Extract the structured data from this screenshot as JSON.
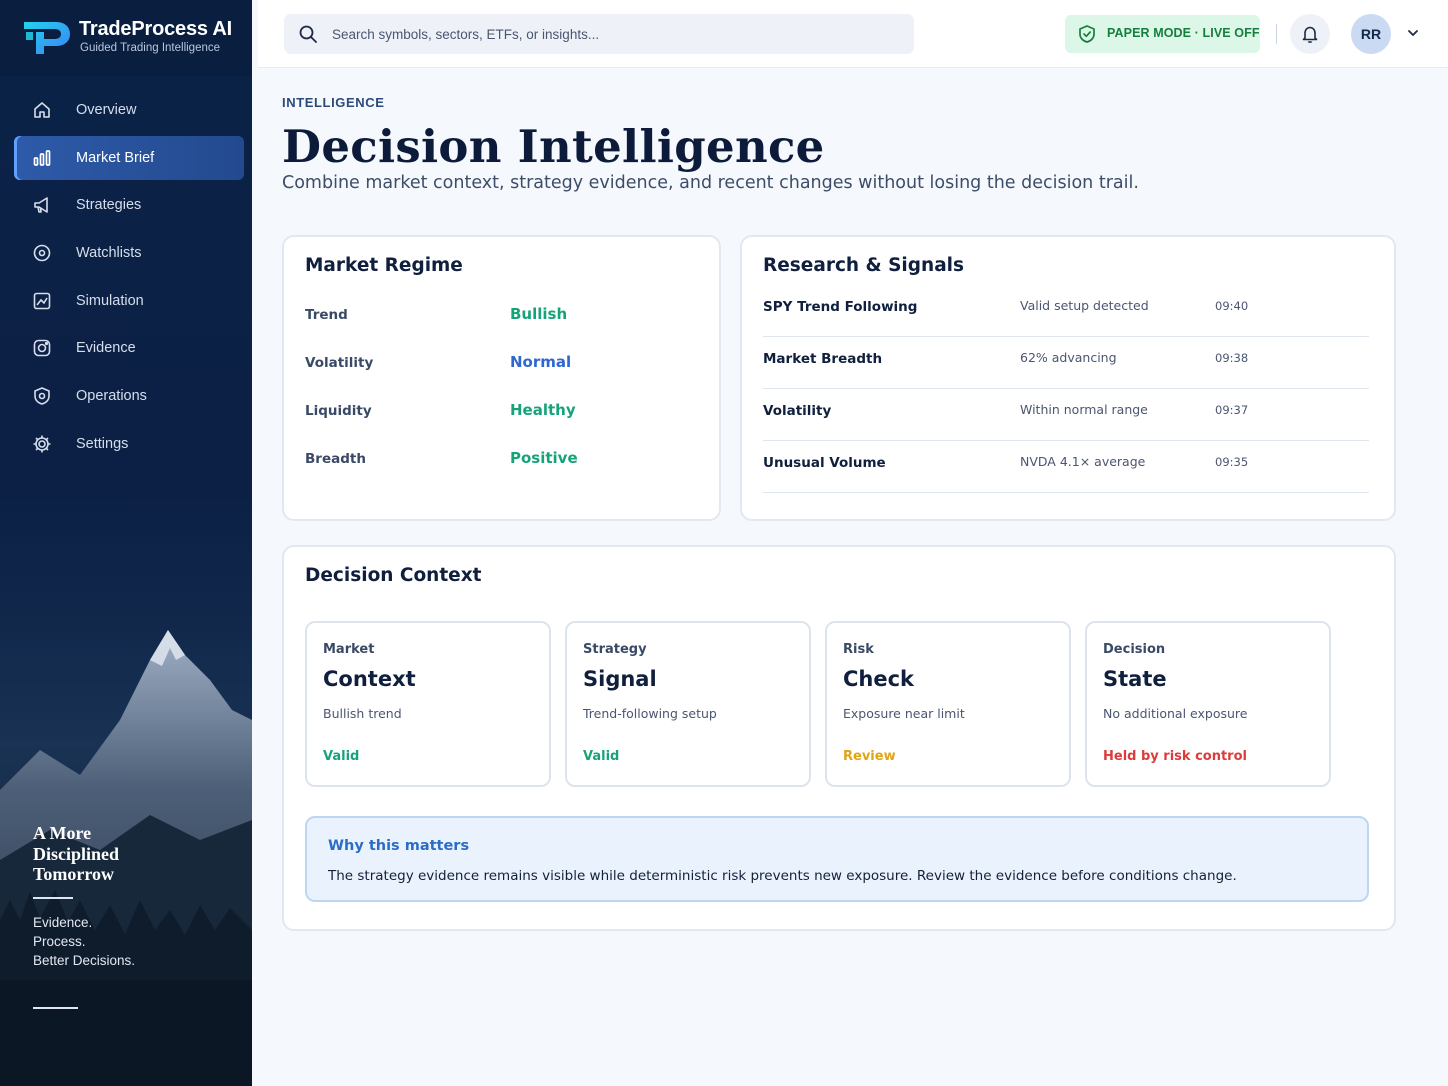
{
  "brand": {
    "name": "TradeProcess AI",
    "tagline": "Guided Trading Intelligence"
  },
  "nav": [
    {
      "label": "Overview",
      "icon": "home-icon",
      "active": false
    },
    {
      "label": "Market Brief",
      "icon": "bar-chart-icon",
      "active": true
    },
    {
      "label": "Strategies",
      "icon": "megaphone-icon",
      "active": false
    },
    {
      "label": "Watchlists",
      "icon": "location-pin-icon",
      "active": false
    },
    {
      "label": "Simulation",
      "icon": "chart-image-icon",
      "active": false
    },
    {
      "label": "Evidence",
      "icon": "camera-icon",
      "active": false
    },
    {
      "label": "Operations",
      "icon": "shield-icon",
      "active": false
    },
    {
      "label": "Settings",
      "icon": "gear-icon",
      "active": false
    }
  ],
  "sidebar_footer": {
    "heading": [
      "A More",
      "Disciplined",
      "Tomorrow"
    ],
    "sub": [
      "Evidence.",
      "Process.",
      "Better Decisions."
    ]
  },
  "topbar": {
    "search_placeholder": "Search symbols, sectors, ETFs, or insights...",
    "mode": "PAPER MODE · LIVE OFF",
    "avatar_initials": "RR"
  },
  "header": {
    "eyebrow": "INTELLIGENCE",
    "title": "Decision Intelligence",
    "subtitle": "Combine market context, strategy evidence, and recent changes without losing the decision trail."
  },
  "market_regime": {
    "title": "Market Regime",
    "rows": [
      {
        "label": "Trend",
        "value": "Bullish",
        "color": "#16a37a"
      },
      {
        "label": "Volatility",
        "value": "Normal",
        "color": "#2f66d0"
      },
      {
        "label": "Liquidity",
        "value": "Healthy",
        "color": "#16a37a"
      },
      {
        "label": "Breadth",
        "value": "Positive",
        "color": "#16a37a"
      }
    ]
  },
  "signals": {
    "title": "Research & Signals",
    "rows": [
      {
        "name": "SPY Trend Following",
        "detail": "Valid setup detected",
        "time": "09:40"
      },
      {
        "name": "Market Breadth",
        "detail": "62% advancing",
        "time": "09:38"
      },
      {
        "name": "Volatility",
        "detail": "Within normal range",
        "time": "09:37"
      },
      {
        "name": "Unusual Volume",
        "detail": "NVDA 4.1× average",
        "time": "09:35"
      }
    ]
  },
  "decision_context": {
    "title": "Decision Context",
    "steps": [
      {
        "eyebrow": "Market",
        "title": "Context",
        "desc": "Bullish trend",
        "status": "Valid",
        "color": "#16a37a"
      },
      {
        "eyebrow": "Strategy",
        "title": "Signal",
        "desc": "Trend-following setup",
        "status": "Valid",
        "color": "#16a37a"
      },
      {
        "eyebrow": "Risk",
        "title": "Check",
        "desc": "Exposure near limit",
        "status": "Review",
        "color": "#e0a516"
      },
      {
        "eyebrow": "Decision",
        "title": "State",
        "desc": "No additional exposure",
        "status": "Held by risk control",
        "color": "#dc3b3b"
      }
    ],
    "why": {
      "title": "Why this matters",
      "body": "The strategy evidence remains visible while deterministic risk prevents new exposure. Review the evidence before conditions change."
    }
  }
}
